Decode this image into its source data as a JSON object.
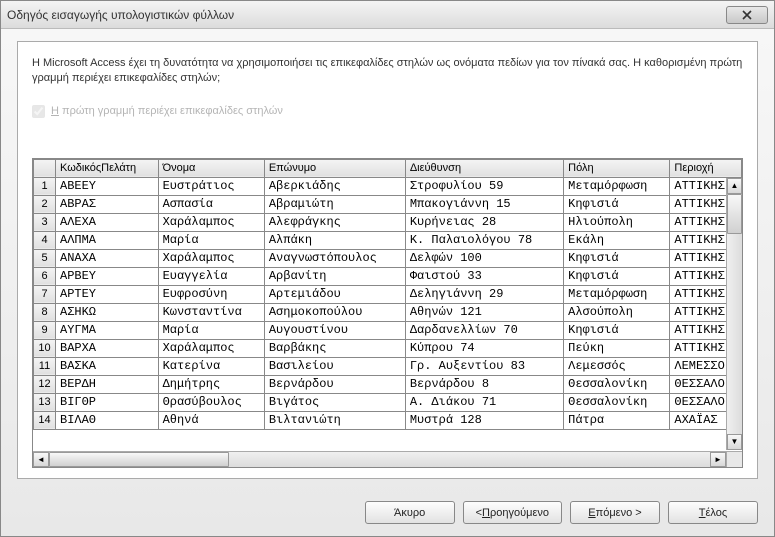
{
  "window": {
    "title": "Οδηγός εισαγωγής υπολογιστικών φύλλων"
  },
  "instruction": "Η Microsoft Access έχει τη δυνατότητα να χρησιμοποιήσει τις επικεφαλίδες στηλών ως ονόματα πεδίων για τον πίνακά σας. Η καθορισμένη πρώτη γραμμή περιέχει επικεφαλίδες στηλών;",
  "checkbox": {
    "label_pre": "Η",
    "label_rest": " πρώτη γραμμή περιέχει επικεφαλίδες στηλών",
    "checked": true
  },
  "columns": [
    "ΚωδικόςΠελάτη",
    "Όνομα",
    "Επώνυμο",
    "Διεύθυνση",
    "Πόλη",
    "Περιοχή"
  ],
  "rows": [
    [
      "ΑΒΕΕΥ",
      "Ευστράτιος",
      "Αβερκιάδης",
      "Στροφυλίου 59",
      "Μεταμόρφωση",
      "ΑΤΤΙΚΗΣ"
    ],
    [
      "ΑΒΡΑΣ",
      "Ασπασία",
      "Αβραμιώτη",
      "Μπακογιάννη 15",
      "Κηφισιά",
      "ΑΤΤΙΚΗΣ"
    ],
    [
      "ΑΛΕΧΑ",
      "Χαράλαμπος",
      "Αλεφράγκης",
      "Κυρήνειας 28",
      "Ηλιούπολη",
      "ΑΤΤΙΚΗΣ"
    ],
    [
      "ΑΛΠΜΑ",
      "Μαρία",
      "Αλπάκη",
      "Κ. Παλαιολόγου 78",
      "Εκάλη",
      "ΑΤΤΙΚΗΣ"
    ],
    [
      "ΑΝΑΧΑ",
      "Χαράλαμπος",
      "Αναγνωστόπουλος",
      "Δελφών 100",
      "Κηφισιά",
      "ΑΤΤΙΚΗΣ"
    ],
    [
      "ΑΡΒΕΥ",
      "Ευαγγελία",
      "Αρβανίτη",
      "Φαιστού 33",
      "Κηφισιά",
      "ΑΤΤΙΚΗΣ"
    ],
    [
      "ΑΡΤΕΥ",
      "Ευφροσύνη",
      "Αρτεμιάδου",
      "Δεληγιάννη 29",
      "Μεταμόρφωση",
      "ΑΤΤΙΚΗΣ"
    ],
    [
      "ΑΣΗΚΩ",
      "Κωνσταντίνα",
      "Ασημοκοπούλου",
      "Αθηνών 121",
      "Αλσούπολη",
      "ΑΤΤΙΚΗΣ"
    ],
    [
      "ΑΥΓΜΑ",
      "Μαρία",
      "Αυγουστίνου",
      "Δαρδανελλίων 70",
      "Κηφισιά",
      "ΑΤΤΙΚΗΣ"
    ],
    [
      "ΒΑΡΧΑ",
      "Χαράλαμπος",
      "Βαρβάκης",
      "Κύπρου 74",
      "Πεύκη",
      "ΑΤΤΙΚΗΣ"
    ],
    [
      "ΒΑΣΚΑ",
      "Κατερίνα",
      "Βασιλείου",
      "Γρ. Αυξεντίου 83",
      "Λεμεσσός",
      "ΛΕΜΕΣΣΟ"
    ],
    [
      "ΒΕΡΔΗ",
      "Δημήτρης",
      "Βερνάρδου",
      "Βερνάρδου 8",
      "Θεσσαλονίκη",
      "ΘΕΣΣΑΛΟ"
    ],
    [
      "ΒΙΓΘΡ",
      "Θρασύβουλος",
      "Βιγάτος",
      "Α. Διάκου 71",
      "Θεσσαλονίκη",
      "ΘΕΣΣΑΛΟ"
    ],
    [
      "ΒΙΛΑΘ",
      "Αθηνά",
      "Βιλτανιώτη",
      "Μυστρά 128",
      "Πάτρα",
      "ΑΧΑΪΑΣ"
    ]
  ],
  "buttons": {
    "cancel": "Άκυρο",
    "back_prefix": "< ",
    "back_u": "Π",
    "back_rest": "ροηγούμενο",
    "next_u": "Ε",
    "next_rest": "πόμενο >",
    "finish_u": "Τ",
    "finish_rest": "έλος"
  }
}
